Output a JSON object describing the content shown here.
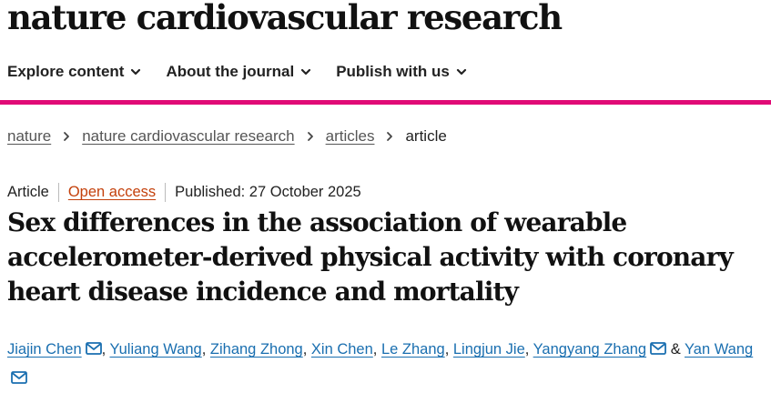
{
  "journal": {
    "title": "nature cardiovascular research"
  },
  "nav": {
    "items": [
      {
        "label": "Explore content",
        "icon": "chevron-down-icon"
      },
      {
        "label": "About the journal",
        "icon": "chevron-down-icon"
      },
      {
        "label": "Publish with us",
        "icon": "chevron-down-icon"
      }
    ]
  },
  "colors": {
    "brand": "#e00a76",
    "link": "#1a6fb0",
    "open_access": "#c4410c",
    "text": "#222222"
  },
  "breadcrumb": {
    "items": [
      "nature",
      "nature cardiovascular research",
      "articles"
    ],
    "current": "article",
    "separator_icon": "chevron-right-icon"
  },
  "meta": {
    "type": "Article",
    "access": "Open access",
    "published": "Published: 27 October 2025"
  },
  "article": {
    "title": "Sex differences in the association of wearable accelerometer-derived physical activity with coronary heart disease incidence and mortality"
  },
  "authors": {
    "list": [
      {
        "name": "Jiajin Chen",
        "email_icon": true
      },
      {
        "name": "Yuliang Wang",
        "email_icon": false
      },
      {
        "name": "Zihang Zhong",
        "email_icon": false
      },
      {
        "name": "Xin Chen",
        "email_icon": false
      },
      {
        "name": "Le Zhang",
        "email_icon": false
      },
      {
        "name": "Lingjun Jie",
        "email_icon": false
      },
      {
        "name": "Yangyang Zhang",
        "email_icon": true
      },
      {
        "name": "Yan Wang",
        "email_icon": true
      }
    ],
    "separator": ", ",
    "last_separator": " & "
  }
}
